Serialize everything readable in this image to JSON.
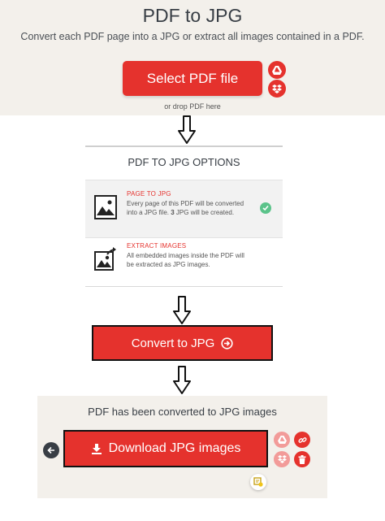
{
  "header": {
    "title": "PDF to JPG",
    "subtitle": "Convert each PDF page into a JPG or extract all images contained in a PDF.",
    "select_button": "Select PDF file",
    "drop_text": "or drop PDF here",
    "upload_sources": [
      "google-drive-icon",
      "dropbox-icon"
    ]
  },
  "options": {
    "title": "PDF TO JPG OPTIONS",
    "items": [
      {
        "name": "PAGE TO JPG",
        "description_before": "Every page of this PDF will be converted into a JPG file. ",
        "count": "3",
        "description_after": " JPG will be created.",
        "selected": true,
        "icon": "image-file-icon"
      },
      {
        "name": "EXTRACT IMAGES",
        "description": "All embedded images inside the PDF will be extracted as JPG images.",
        "selected": false,
        "icon": "image-export-icon"
      }
    ]
  },
  "convert": {
    "label": "Convert to JPG"
  },
  "result": {
    "title": "PDF has been converted to JPG images",
    "download_label": "Download JPG images"
  },
  "colors": {
    "accent": "#e5322d",
    "pale_accent": "#f29b99",
    "background_beige": "#f3f0eb",
    "dark": "#383e45",
    "check_green": "#5bc38a"
  }
}
